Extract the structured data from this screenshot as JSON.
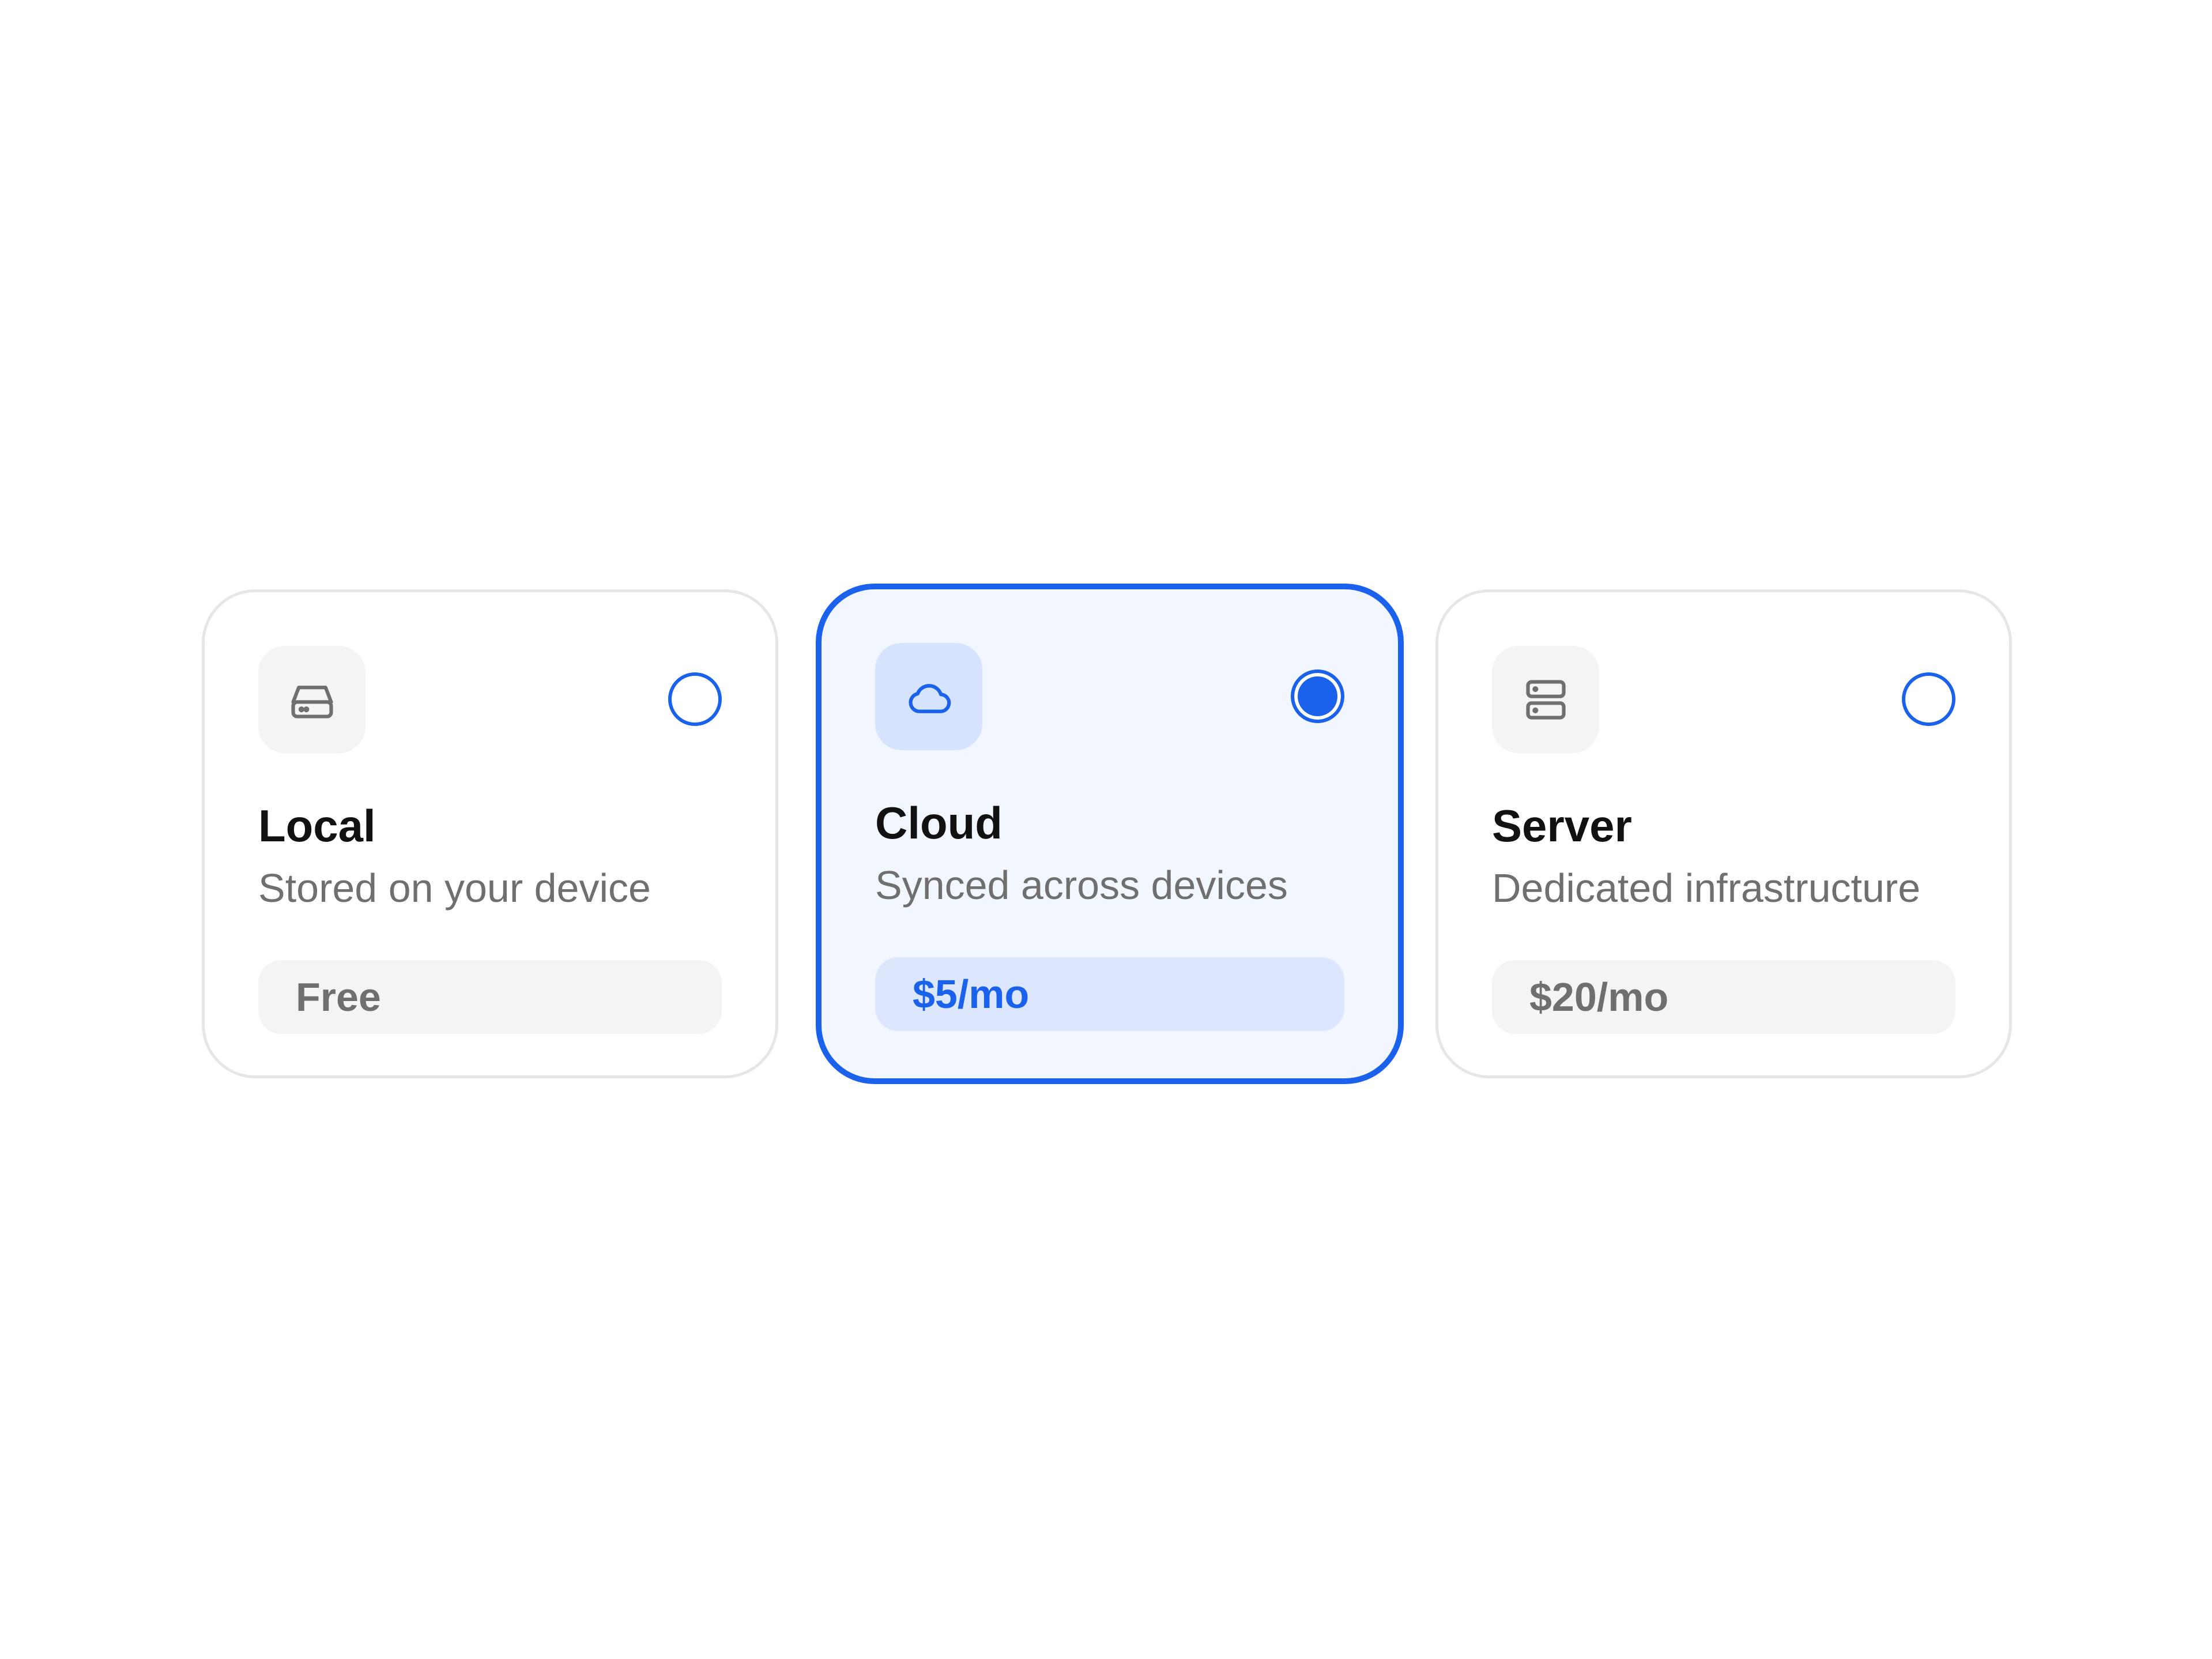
{
  "accent_color": "#1a62ec",
  "selected_option": "cloud",
  "options": [
    {
      "id": "local",
      "title": "Local",
      "description": "Stored on your device",
      "price": "Free",
      "icon": "hard-drive-icon",
      "selected": false
    },
    {
      "id": "cloud",
      "title": "Cloud",
      "description": "Synced across devices",
      "price": "$5/mo",
      "icon": "cloud-icon",
      "selected": true
    },
    {
      "id": "server",
      "title": "Server",
      "description": "Dedicated infrastructure",
      "price": "$20/mo",
      "icon": "server-icon",
      "selected": false
    }
  ]
}
